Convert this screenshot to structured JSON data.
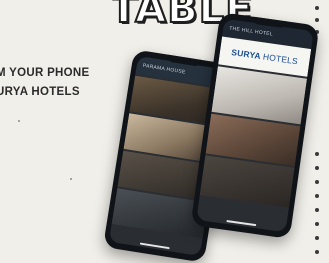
{
  "headline": "TABLE",
  "tagline": {
    "line1": "M YOUR PHONE",
    "line2": "URYA HOTELS"
  },
  "back_phone": {
    "app_title": "PARAMA HOUSE"
  },
  "front_phone": {
    "app_title": "THE HILL HOTEL",
    "brand_bold": "SURYA",
    "brand_thin": "HOTELS"
  },
  "colors": {
    "background": "#f1efe9",
    "brand_blue": "#1c4f91",
    "dark_text": "#2b2b2b"
  }
}
